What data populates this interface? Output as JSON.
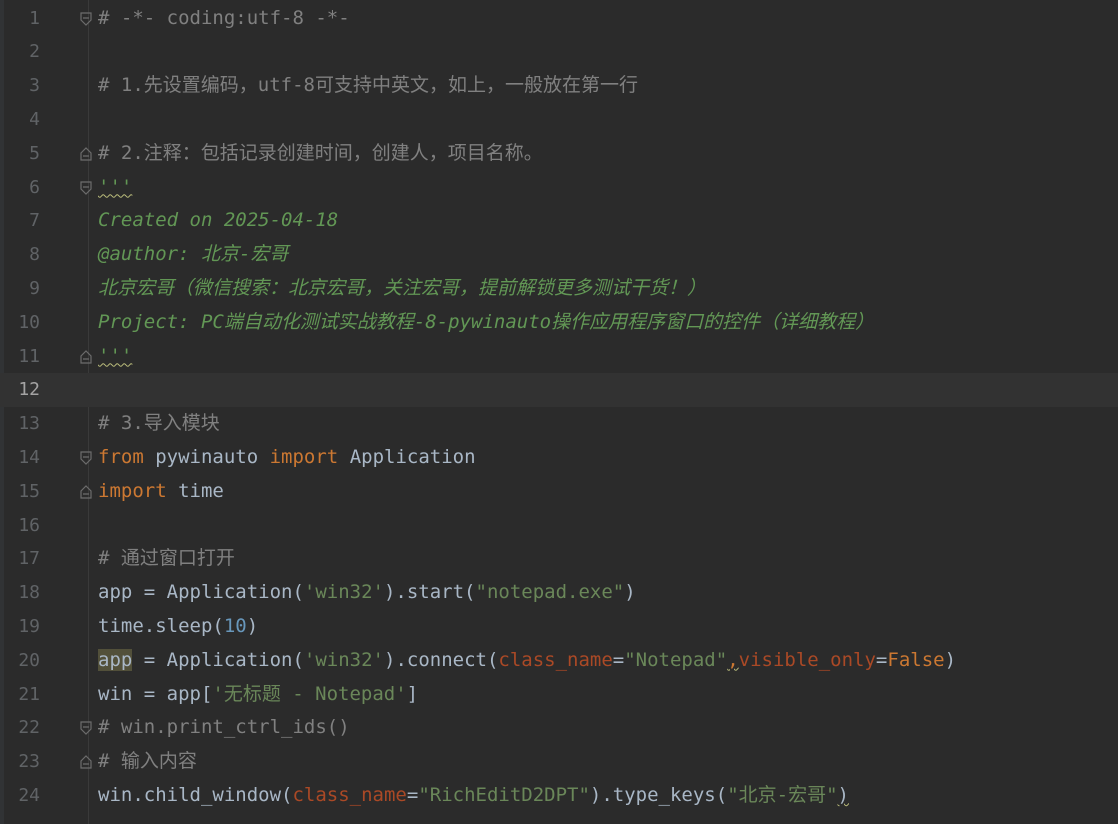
{
  "editor": {
    "current_line": 12,
    "lines": [
      {
        "n": "1",
        "fold": "open",
        "parts": [
          {
            "t": "# -*- coding:utf-8 -*-",
            "c": "cm"
          }
        ]
      },
      {
        "n": "2",
        "fold": "",
        "parts": []
      },
      {
        "n": "3",
        "fold": "",
        "parts": [
          {
            "t": "# 1.先设置编码，utf-8可支持中英文，如上，一般放在第一行",
            "c": "cm"
          }
        ]
      },
      {
        "n": "4",
        "fold": "",
        "parts": []
      },
      {
        "n": "5",
        "fold": "end",
        "parts": [
          {
            "t": "# 2.注释：包括记录创建时间，创建人，项目名称。",
            "c": "cm"
          }
        ]
      },
      {
        "n": "6",
        "fold": "open",
        "parts": [
          {
            "t": "'''",
            "c": "doc squig"
          }
        ]
      },
      {
        "n": "7",
        "fold": "",
        "parts": [
          {
            "t": "Created on 2025-04-18",
            "c": "doc"
          }
        ]
      },
      {
        "n": "8",
        "fold": "",
        "parts": [
          {
            "t": "@author: 北京-宏哥",
            "c": "doc"
          }
        ]
      },
      {
        "n": "9",
        "fold": "",
        "parts": [
          {
            "t": "北京宏哥（微信搜索：北京宏哥，关注宏哥，提前解锁更多测试干货！）",
            "c": "doc"
          }
        ]
      },
      {
        "n": "10",
        "fold": "",
        "parts": [
          {
            "t": "Project: PC端自动化测试实战教程-8-pywinauto操作应用程序窗口的控件（详细教程）",
            "c": "doc"
          }
        ]
      },
      {
        "n": "11",
        "fold": "end",
        "parts": [
          {
            "t": "'''",
            "c": "doc squig"
          }
        ]
      },
      {
        "n": "12",
        "fold": "",
        "parts": []
      },
      {
        "n": "13",
        "fold": "",
        "parts": [
          {
            "t": "# 3.导入模块",
            "c": "cm"
          }
        ]
      },
      {
        "n": "14",
        "fold": "open",
        "parts": [
          {
            "t": "from",
            "c": "kw"
          },
          {
            "t": " pywinauto ",
            "c": ""
          },
          {
            "t": "import",
            "c": "kw"
          },
          {
            "t": " Application",
            "c": ""
          }
        ]
      },
      {
        "n": "15",
        "fold": "end",
        "parts": [
          {
            "t": "import",
            "c": "kw"
          },
          {
            "t": " time",
            "c": ""
          }
        ]
      },
      {
        "n": "16",
        "fold": "",
        "parts": []
      },
      {
        "n": "17",
        "fold": "",
        "parts": [
          {
            "t": "# 通过窗口打开",
            "c": "cm"
          }
        ]
      },
      {
        "n": "18",
        "fold": "",
        "parts": [
          {
            "t": "app = Application(",
            "c": ""
          },
          {
            "t": "'win32'",
            "c": "str"
          },
          {
            "t": ").start(",
            "c": ""
          },
          {
            "t": "\"notepad.exe\"",
            "c": "str"
          },
          {
            "t": ")",
            "c": ""
          }
        ]
      },
      {
        "n": "19",
        "fold": "",
        "parts": [
          {
            "t": "time.sleep(",
            "c": ""
          },
          {
            "t": "10",
            "c": "num"
          },
          {
            "t": ")",
            "c": ""
          }
        ]
      },
      {
        "n": "20",
        "fold": "",
        "parts": [
          {
            "t": "app",
            "c": "hl"
          },
          {
            "t": " = Application(",
            "c": ""
          },
          {
            "t": "'win32'",
            "c": "str"
          },
          {
            "t": ").connect(",
            "c": ""
          },
          {
            "t": "class_name",
            "c": "param"
          },
          {
            "t": "=",
            "c": ""
          },
          {
            "t": "\"Notepad\"",
            "c": "str"
          },
          {
            "t": ",",
            "c": "kw squig"
          },
          {
            "t": "visible_only",
            "c": "param"
          },
          {
            "t": "=",
            "c": ""
          },
          {
            "t": "False",
            "c": "kw"
          },
          {
            "t": ")",
            "c": ""
          }
        ]
      },
      {
        "n": "21",
        "fold": "",
        "parts": [
          {
            "t": "win = app[",
            "c": ""
          },
          {
            "t": "'无标题 - Notepad'",
            "c": "str"
          },
          {
            "t": "]",
            "c": ""
          }
        ]
      },
      {
        "n": "22",
        "fold": "open",
        "parts": [
          {
            "t": "# win.print_ctrl_ids()",
            "c": "cm"
          }
        ]
      },
      {
        "n": "23",
        "fold": "end",
        "parts": [
          {
            "t": "# 输入内容",
            "c": "cm"
          }
        ]
      },
      {
        "n": "24",
        "fold": "",
        "parts": [
          {
            "t": "win.child_window(",
            "c": ""
          },
          {
            "t": "class_name",
            "c": "param"
          },
          {
            "t": "=",
            "c": ""
          },
          {
            "t": "\"RichEditD2DPT\"",
            "c": "str"
          },
          {
            "t": ").type_keys(",
            "c": ""
          },
          {
            "t": "\"北京-宏哥\"",
            "c": "str"
          },
          {
            "t": ")",
            "c": "squig"
          }
        ]
      }
    ]
  },
  "colors": {
    "background": "#2b2b2b",
    "comment": "#808080",
    "docstring": "#629755",
    "keyword": "#cc7832",
    "string": "#6a8759",
    "number": "#6897bb",
    "parameter": "#aa4926",
    "default": "#a9b7c6"
  },
  "icons": {
    "fold_open": "fold-open-icon",
    "fold_end": "fold-end-icon"
  }
}
